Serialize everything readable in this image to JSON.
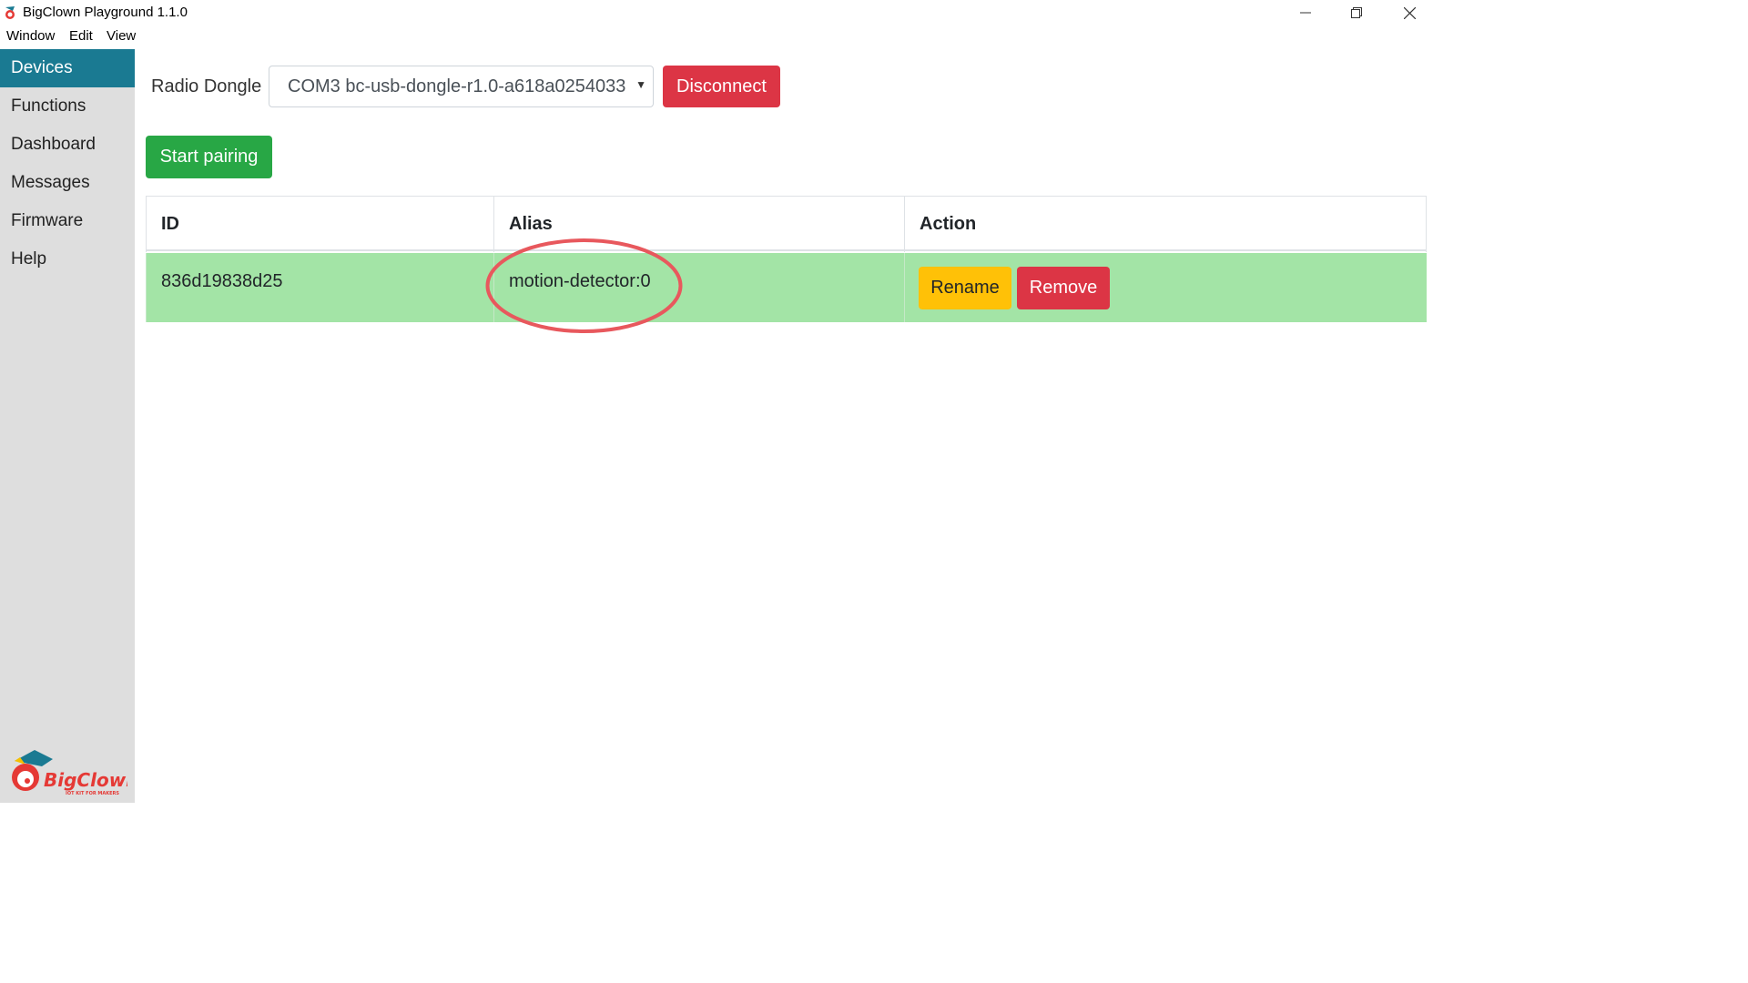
{
  "window": {
    "title": "BigClown Playground 1.1.0",
    "menu": [
      "Window",
      "Edit",
      "View"
    ]
  },
  "sidebar": {
    "items": [
      {
        "label": "Devices",
        "active": true
      },
      {
        "label": "Functions",
        "active": false
      },
      {
        "label": "Dashboard",
        "active": false
      },
      {
        "label": "Messages",
        "active": false
      },
      {
        "label": "Firmware",
        "active": false
      },
      {
        "label": "Help",
        "active": false
      }
    ],
    "logo_text": "BigClown",
    "logo_tagline": "IOT KIT FOR MAKERS"
  },
  "dongle": {
    "label": "Radio Dongle",
    "selected": "COM3 bc-usb-dongle-r1.0-a618a0254033",
    "disconnect_label": "Disconnect"
  },
  "pairing": {
    "start_label": "Start pairing"
  },
  "table": {
    "headers": [
      "ID",
      "Alias",
      "Action"
    ],
    "rows": [
      {
        "id": "836d19838d25",
        "alias": "motion-detector:0",
        "rename_label": "Rename",
        "remove_label": "Remove"
      }
    ]
  },
  "colors": {
    "sidebar_active": "#1a7a92",
    "danger": "#dc3545",
    "success": "#28a745",
    "warning": "#ffc107",
    "row_highlight": "#a3e4a6",
    "annotation": "#e8585d"
  },
  "icons": [
    "app-icon",
    "minimize-icon",
    "restore-icon",
    "close-icon",
    "dropdown-arrow-icon"
  ]
}
